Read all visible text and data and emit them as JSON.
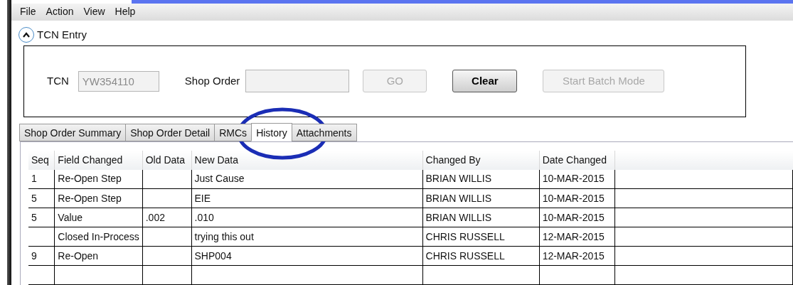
{
  "menu": [
    "File",
    "Action",
    "View",
    "Help"
  ],
  "section": {
    "title": "TCN Entry",
    "expanded": true
  },
  "form": {
    "tcn_label": "TCN",
    "tcn_value": "YW354110",
    "shop_order_label": "Shop Order",
    "buttons": [
      {
        "label": "GO",
        "disabled": true
      },
      {
        "label": "Clear",
        "disabled": false
      },
      {
        "label": "Start Batch Mode",
        "disabled": true
      }
    ]
  },
  "tabs": [
    {
      "label": "Shop Order Summary",
      "selected": false
    },
    {
      "label": "Shop Order Detail",
      "selected": false
    },
    {
      "label": "RMCs",
      "selected": false
    },
    {
      "label": "History",
      "selected": true
    },
    {
      "label": "Attachments",
      "selected": false
    }
  ],
  "table": {
    "columns": [
      "Seq",
      "Field Changed",
      "Old Data",
      "New Data",
      "Changed By",
      "Date Changed"
    ],
    "rows": [
      [
        "1",
        "Re-Open Step",
        "",
        "Just Cause",
        "BRIAN WILLIS",
        "10-MAR-2015"
      ],
      [
        "5",
        "Re-Open Step",
        "",
        "EIE",
        "BRIAN WILLIS",
        "10-MAR-2015"
      ],
      [
        "5",
        "Value",
        ".002",
        ".010",
        "BRIAN WILLIS",
        "10-MAR-2015"
      ],
      [
        "",
        "Closed In-Process",
        "",
        "trying this out",
        "CHRIS RUSSELL",
        "12-MAR-2015"
      ],
      [
        "9",
        "Re-Open",
        "",
        "SHP004",
        "CHRIS RUSSELL",
        "12-MAR-2015"
      ]
    ]
  }
}
